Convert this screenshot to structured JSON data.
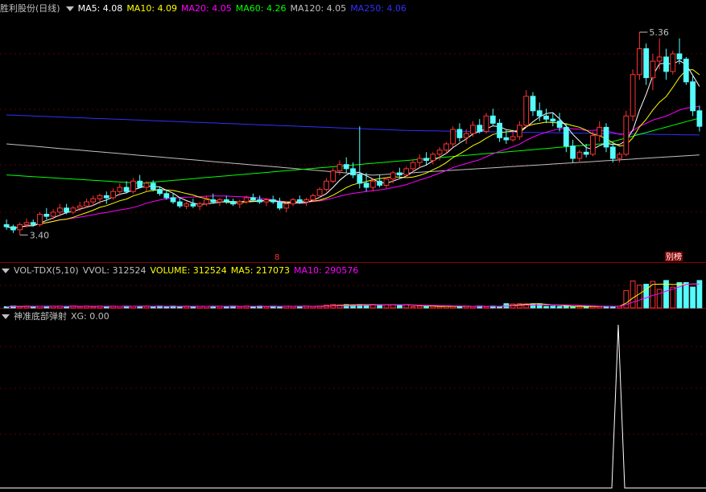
{
  "main_panel": {
    "stock_title": "胜利股份(日线)",
    "indicators": [
      {
        "label": "MA5: 4.08",
        "color": "#ffffff"
      },
      {
        "label": "MA10: 4.09",
        "color": "#ffff00"
      },
      {
        "label": "MA20: 4.05",
        "color": "#ff00ff"
      },
      {
        "label": "MA60: 4.26",
        "color": "#00ff00"
      },
      {
        "label": "MA120: 4.05",
        "color": "#c0c0c0"
      },
      {
        "label": "MA250: 4.06",
        "color": "#3030ff"
      }
    ],
    "high_label": "5.36",
    "low_label": "3.40",
    "marker_1": "8",
    "marker_2": "别榜"
  },
  "volume_panel": {
    "title": "VOL-TDX(5,10)",
    "indicators": [
      {
        "label": "VVOL: 312524",
        "color": "#c0c0c0"
      },
      {
        "label": "VOLUME: 312524",
        "color": "#ffff00"
      },
      {
        "label": "MA5: 217073",
        "color": "#ffff00"
      },
      {
        "label": "MA10: 290576",
        "color": "#ff00ff"
      }
    ]
  },
  "signal_panel": {
    "title": "神准底部弹射",
    "indicators": [
      {
        "label": "XG: 0.00",
        "color": "#c0c0c0"
      }
    ]
  },
  "chart_data": {
    "type": "candlestick",
    "ylim": [
      3.2,
      5.5
    ],
    "candles_ohlc": [
      [
        3.5,
        3.55,
        3.45,
        3.48
      ],
      [
        3.48,
        3.5,
        3.42,
        3.45
      ],
      [
        3.45,
        3.52,
        3.4,
        3.5
      ],
      [
        3.5,
        3.56,
        3.47,
        3.52
      ],
      [
        3.52,
        3.55,
        3.48,
        3.5
      ],
      [
        3.5,
        3.62,
        3.48,
        3.6
      ],
      [
        3.6,
        3.66,
        3.55,
        3.58
      ],
      [
        3.58,
        3.65,
        3.55,
        3.62
      ],
      [
        3.62,
        3.7,
        3.58,
        3.66
      ],
      [
        3.66,
        3.7,
        3.6,
        3.62
      ],
      [
        3.62,
        3.68,
        3.6,
        3.66
      ],
      [
        3.66,
        3.72,
        3.63,
        3.68
      ],
      [
        3.68,
        3.75,
        3.66,
        3.72
      ],
      [
        3.72,
        3.78,
        3.68,
        3.75
      ],
      [
        3.75,
        3.8,
        3.7,
        3.78
      ],
      [
        3.78,
        3.82,
        3.7,
        3.76
      ],
      [
        3.76,
        3.85,
        3.74,
        3.82
      ],
      [
        3.82,
        3.9,
        3.78,
        3.86
      ],
      [
        3.86,
        3.92,
        3.8,
        3.82
      ],
      [
        3.82,
        3.95,
        3.8,
        3.92
      ],
      [
        3.92,
        3.98,
        3.85,
        3.86
      ],
      [
        3.86,
        3.92,
        3.82,
        3.9
      ],
      [
        3.9,
        3.93,
        3.82,
        3.84
      ],
      [
        3.84,
        3.86,
        3.78,
        3.8
      ],
      [
        3.8,
        3.84,
        3.74,
        3.76
      ],
      [
        3.76,
        3.8,
        3.7,
        3.72
      ],
      [
        3.72,
        3.76,
        3.66,
        3.68
      ],
      [
        3.68,
        3.72,
        3.65,
        3.7
      ],
      [
        3.7,
        3.75,
        3.66,
        3.68
      ],
      [
        3.68,
        3.72,
        3.64,
        3.7
      ],
      [
        3.7,
        3.78,
        3.68,
        3.74
      ],
      [
        3.74,
        3.8,
        3.7,
        3.72
      ],
      [
        3.72,
        3.76,
        3.68,
        3.74
      ],
      [
        3.74,
        3.78,
        3.7,
        3.72
      ],
      [
        3.72,
        3.75,
        3.68,
        3.7
      ],
      [
        3.7,
        3.74,
        3.66,
        3.72
      ],
      [
        3.72,
        3.78,
        3.7,
        3.76
      ],
      [
        3.76,
        3.8,
        3.72,
        3.74
      ],
      [
        3.74,
        3.78,
        3.7,
        3.72
      ],
      [
        3.72,
        3.76,
        3.68,
        3.74
      ],
      [
        3.74,
        3.78,
        3.7,
        3.72
      ],
      [
        3.72,
        3.76,
        3.64,
        3.66
      ],
      [
        3.66,
        3.72,
        3.62,
        3.7
      ],
      [
        3.7,
        3.76,
        3.68,
        3.74
      ],
      [
        3.74,
        3.78,
        3.7,
        3.72
      ],
      [
        3.72,
        3.76,
        3.68,
        3.74
      ],
      [
        3.74,
        3.8,
        3.72,
        3.78
      ],
      [
        3.78,
        3.86,
        3.76,
        3.84
      ],
      [
        3.84,
        3.95,
        3.82,
        3.92
      ],
      [
        3.92,
        4.05,
        3.9,
        4.02
      ],
      [
        4.02,
        4.12,
        3.98,
        4.08
      ],
      [
        4.08,
        4.15,
        4.0,
        4.04
      ],
      [
        4.04,
        4.1,
        3.95,
        3.98
      ],
      [
        3.98,
        4.45,
        3.85,
        3.9
      ],
      [
        3.9,
        4.0,
        3.82,
        3.86
      ],
      [
        3.86,
        3.95,
        3.82,
        3.92
      ],
      [
        3.92,
        3.98,
        3.86,
        3.88
      ],
      [
        3.88,
        3.96,
        3.85,
        3.94
      ],
      [
        3.94,
        4.02,
        3.9,
        4.0
      ],
      [
        4.0,
        4.05,
        3.95,
        3.98
      ],
      [
        3.98,
        4.06,
        3.95,
        4.04
      ],
      [
        4.04,
        4.12,
        4.0,
        4.1
      ],
      [
        4.1,
        4.18,
        4.05,
        4.14
      ],
      [
        4.14,
        4.2,
        4.08,
        4.12
      ],
      [
        4.12,
        4.2,
        4.08,
        4.18
      ],
      [
        4.18,
        4.25,
        4.12,
        4.22
      ],
      [
        4.22,
        4.3,
        4.18,
        4.28
      ],
      [
        4.28,
        4.45,
        4.25,
        4.42
      ],
      [
        4.42,
        4.48,
        4.3,
        4.34
      ],
      [
        4.34,
        4.42,
        4.28,
        4.38
      ],
      [
        4.38,
        4.5,
        4.35,
        4.46
      ],
      [
        4.46,
        4.52,
        4.38,
        4.4
      ],
      [
        4.4,
        4.58,
        4.38,
        4.55
      ],
      [
        4.55,
        4.62,
        4.45,
        4.48
      ],
      [
        4.48,
        4.52,
        4.3,
        4.34
      ],
      [
        4.34,
        4.42,
        4.28,
        4.32
      ],
      [
        4.32,
        4.4,
        4.3,
        4.35
      ],
      [
        4.35,
        4.5,
        4.32,
        4.46
      ],
      [
        4.46,
        4.8,
        4.44,
        4.74
      ],
      [
        4.74,
        4.78,
        4.55,
        4.6
      ],
      [
        4.6,
        4.68,
        4.5,
        4.55
      ],
      [
        4.55,
        4.62,
        4.48,
        4.52
      ],
      [
        4.52,
        4.58,
        4.45,
        4.5
      ],
      [
        4.5,
        4.58,
        4.4,
        4.44
      ],
      [
        4.44,
        4.48,
        4.2,
        4.26
      ],
      [
        4.26,
        4.32,
        4.1,
        4.14
      ],
      [
        4.14,
        4.22,
        4.1,
        4.2
      ],
      [
        4.2,
        4.28,
        4.15,
        4.18
      ],
      [
        4.18,
        4.4,
        4.16,
        4.36
      ],
      [
        4.36,
        4.5,
        4.3,
        4.44
      ],
      [
        4.44,
        4.48,
        4.2,
        4.25
      ],
      [
        4.25,
        4.3,
        4.1,
        4.14
      ],
      [
        4.14,
        4.2,
        4.1,
        4.18
      ],
      [
        4.18,
        4.6,
        4.16,
        4.55
      ],
      [
        4.55,
        5.0,
        4.5,
        4.95
      ],
      [
        4.95,
        5.36,
        4.9,
        5.2
      ],
      [
        5.2,
        5.25,
        4.85,
        4.92
      ],
      [
        4.92,
        5.15,
        4.8,
        5.08
      ],
      [
        5.08,
        5.3,
        5.0,
        5.12
      ],
      [
        5.12,
        5.2,
        4.9,
        4.98
      ],
      [
        4.98,
        5.18,
        4.95,
        5.15
      ],
      [
        5.15,
        5.3,
        5.05,
        5.1
      ],
      [
        5.1,
        5.12,
        4.85,
        4.88
      ],
      [
        4.88,
        4.95,
        4.55,
        4.6
      ],
      [
        4.6,
        4.65,
        4.4,
        4.45
      ]
    ]
  }
}
